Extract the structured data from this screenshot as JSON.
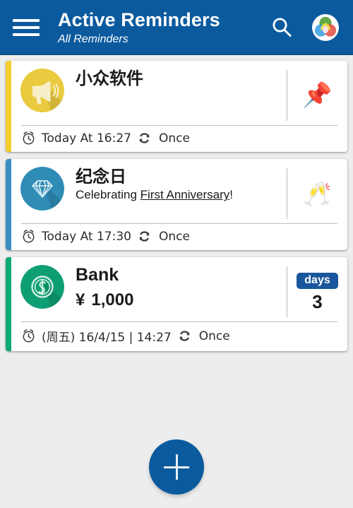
{
  "theme": {
    "primary": "#0B5A9E",
    "page_background": "#EDEDED",
    "card_background": "#FFFFFF",
    "badge_blue": "#19579C"
  },
  "header": {
    "menu_icon": "hamburger-menu-icon",
    "title": "Active Reminders",
    "subtitle": "All Reminders",
    "search_icon": "search-icon",
    "filter_icon": "color-filter-icon"
  },
  "reminders": [
    {
      "stripe_color": "#F5CE2E",
      "avatar_icon": "megaphone-icon",
      "avatar_bg": "#EACA3F",
      "title": "小众软件",
      "subtitle": null,
      "amount": null,
      "right_type": "emoji",
      "right_emoji": "📌",
      "right_emoji_name": "pushpin-emoji",
      "clock_icon": "alarm-clock-icon",
      "when": "Today At 16:27",
      "repeat_icon": "repeat-icon",
      "repeat": "Once"
    },
    {
      "stripe_color": "#3B8FC4",
      "avatar_icon": "diamond-icon",
      "avatar_bg": "#2E8CB5",
      "title": "纪念日",
      "subtitle_prefix": "Celebrating ",
      "subtitle_link": "First Anniversary",
      "subtitle_suffix": "!",
      "amount": null,
      "right_type": "emoji",
      "right_emoji": "🥂",
      "right_emoji_name": "clinking-glasses-emoji",
      "clock_icon": "alarm-clock-icon",
      "when": "Today At 17:30",
      "repeat_icon": "repeat-icon",
      "repeat": "Once"
    },
    {
      "stripe_color": "#0DAA72",
      "avatar_icon": "money-coin-icon",
      "avatar_bg": "#0E9E73",
      "title": "Bank",
      "subtitle": null,
      "amount_symbol": "¥",
      "amount_value": "1,000",
      "right_type": "days",
      "days_label": "days",
      "days_count": "3",
      "clock_icon": "alarm-clock-icon",
      "when": "(周五) 16/4/15 | 14:27",
      "repeat_icon": "repeat-icon",
      "repeat": "Once"
    }
  ],
  "fab": {
    "icon": "plus-icon",
    "label": "Add reminder"
  }
}
